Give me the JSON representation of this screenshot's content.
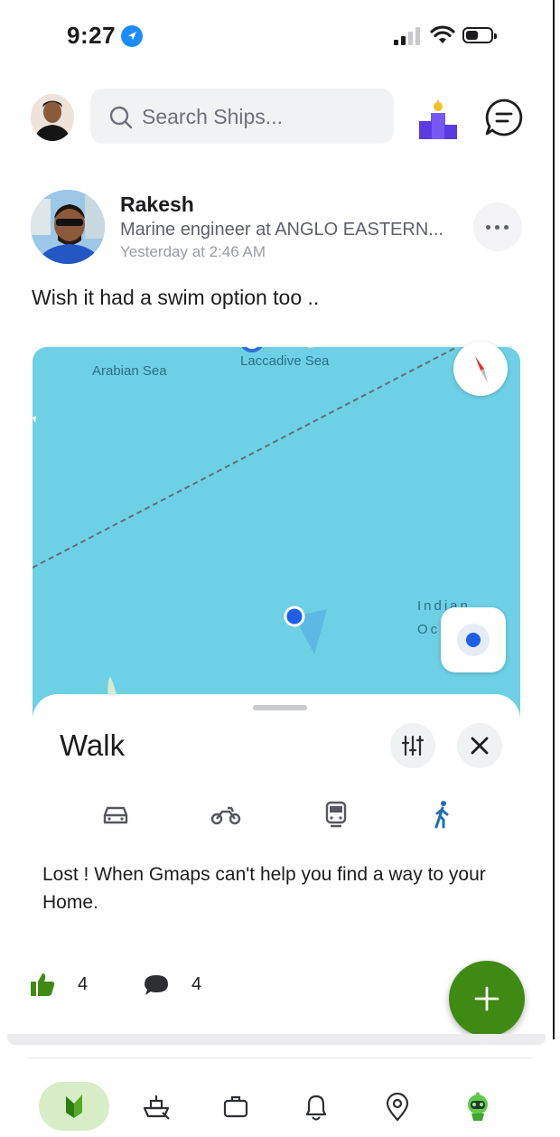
{
  "status_bar": {
    "time": "9:27"
  },
  "header": {
    "search_placeholder": "Search Ships..."
  },
  "post": {
    "author": "Rakesh",
    "role": "Marine engineer at ANGLO EASTERN...",
    "timestamp": "Yesterday at 2:46 AM",
    "text": "Wish it had a swim option too ..",
    "map": {
      "labels": {
        "sea1": "Arabian Sea",
        "sea2": "Laccadive Sea",
        "ocean_line1": "Indian",
        "ocean_line2": "Oc"
      },
      "sheet_title": "Walk",
      "modes": [
        "car-icon",
        "motorbike-icon",
        "train-icon",
        "walk-icon"
      ],
      "active_mode": "walk-icon",
      "accent_color": "#1f6fb5"
    },
    "caption": "Lost ! When Gmaps can't help you find a way to your Home.",
    "likes": "4",
    "comments": "4"
  },
  "colors": {
    "brand_green": "#3f8a13",
    "map_water": "#6dd0e4",
    "location_blue": "#1f5fe8"
  },
  "bottom_nav": [
    "home-logo-icon",
    "ship-icon",
    "briefcase-icon",
    "bell-icon",
    "location-pin-icon",
    "bot-icon"
  ]
}
